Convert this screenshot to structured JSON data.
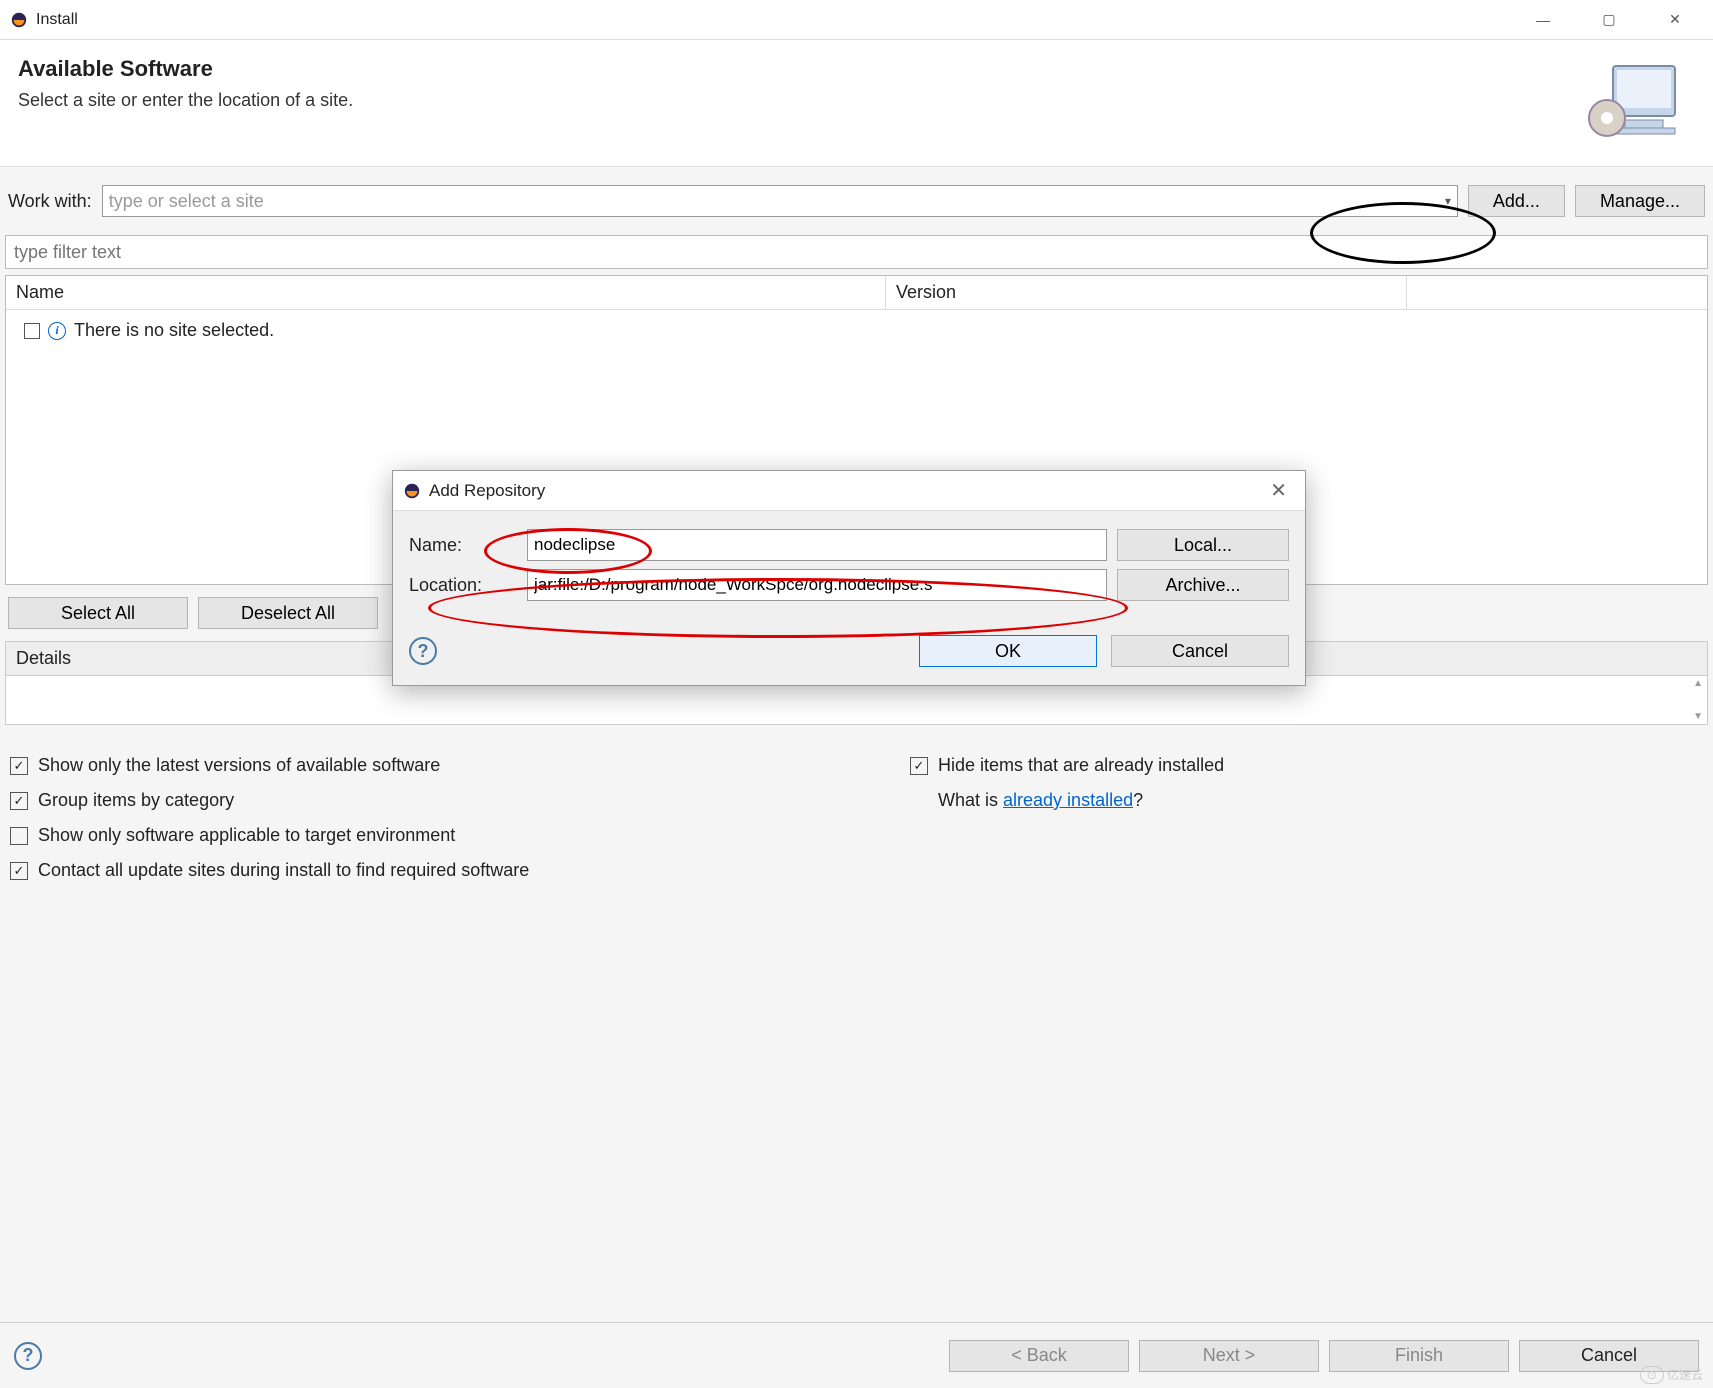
{
  "window": {
    "title": "Install",
    "controls": {
      "min": "—",
      "max": "▢",
      "close": "✕"
    }
  },
  "header": {
    "heading": "Available Software",
    "subtext": "Select a site or enter the location of a site."
  },
  "workWith": {
    "label": "Work with:",
    "placeholder": "type or select a site",
    "addBtn": "Add...",
    "manageBtn": "Manage..."
  },
  "filter": {
    "placeholder": "type filter text"
  },
  "tree": {
    "cols": {
      "name": "Name",
      "version": "Version"
    },
    "noSite": "There is no site selected."
  },
  "selection": {
    "selectAll": "Select All",
    "deselectAll": "Deselect All"
  },
  "details": {
    "label": "Details"
  },
  "options": {
    "latest": "Show only the latest versions of available software",
    "group": "Group items by category",
    "target": "Show only software applicable to target environment",
    "contact": "Contact all update sites during install to find required software",
    "hide": "Hide items that are already installed",
    "whatIsPrefix": "What is ",
    "whatIsLink": "already installed",
    "whatIsSuffix": "?"
  },
  "footer": {
    "back": "< Back",
    "next": "Next >",
    "finish": "Finish",
    "cancel": "Cancel"
  },
  "dialog": {
    "title": "Add Repository",
    "nameLabel": "Name:",
    "nameValue": "nodeclipse",
    "locationLabel": "Location:",
    "locationValue": "jar:file:/D:/program/node_WorkSpce/org.nodeclipse.s",
    "localBtn": "Local...",
    "archiveBtn": "Archive...",
    "ok": "OK",
    "cancel": "Cancel"
  },
  "watermark": {
    "text": "亿速云"
  }
}
